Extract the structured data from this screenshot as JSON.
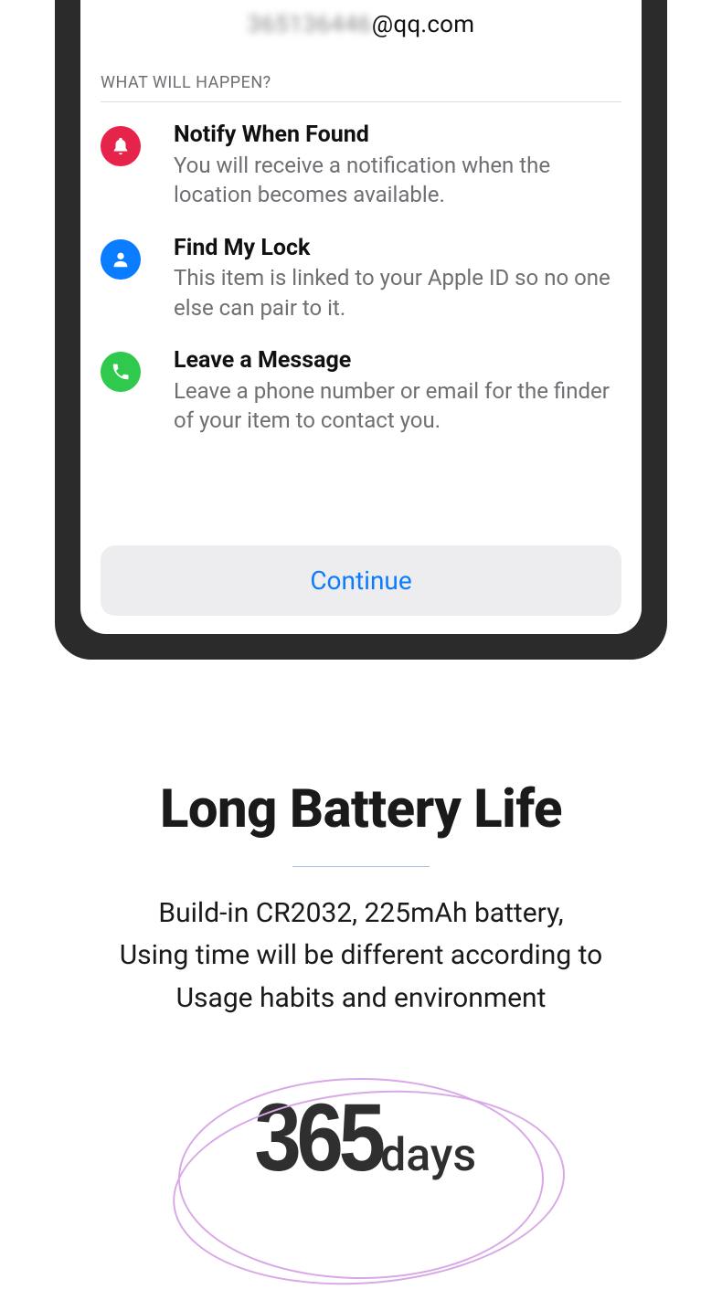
{
  "email": {
    "blurred_part": "365136446",
    "visible_part": "@qq.com"
  },
  "section_title": "WHAT WILL HAPPEN?",
  "items": [
    {
      "icon": "bell-icon",
      "title": "Notify When Found",
      "desc": "You will receive a notification when the location becomes available."
    },
    {
      "icon": "person-icon",
      "title": "Find My Lock",
      "desc": "This item is linked to your Apple ID so no one else can pair to it."
    },
    {
      "icon": "phone-icon",
      "title": "Leave a Message",
      "desc": "Leave a phone number or email for the finder of your item to contact you."
    }
  ],
  "continue_label": "Continue",
  "battery": {
    "title": "Long Battery Life",
    "desc_line1": "Build-in CR2032, 225mAh battery,",
    "desc_line2": "Using time will be different according to",
    "desc_line3": "Usage habits and environment",
    "number": "365",
    "unit": "days"
  }
}
